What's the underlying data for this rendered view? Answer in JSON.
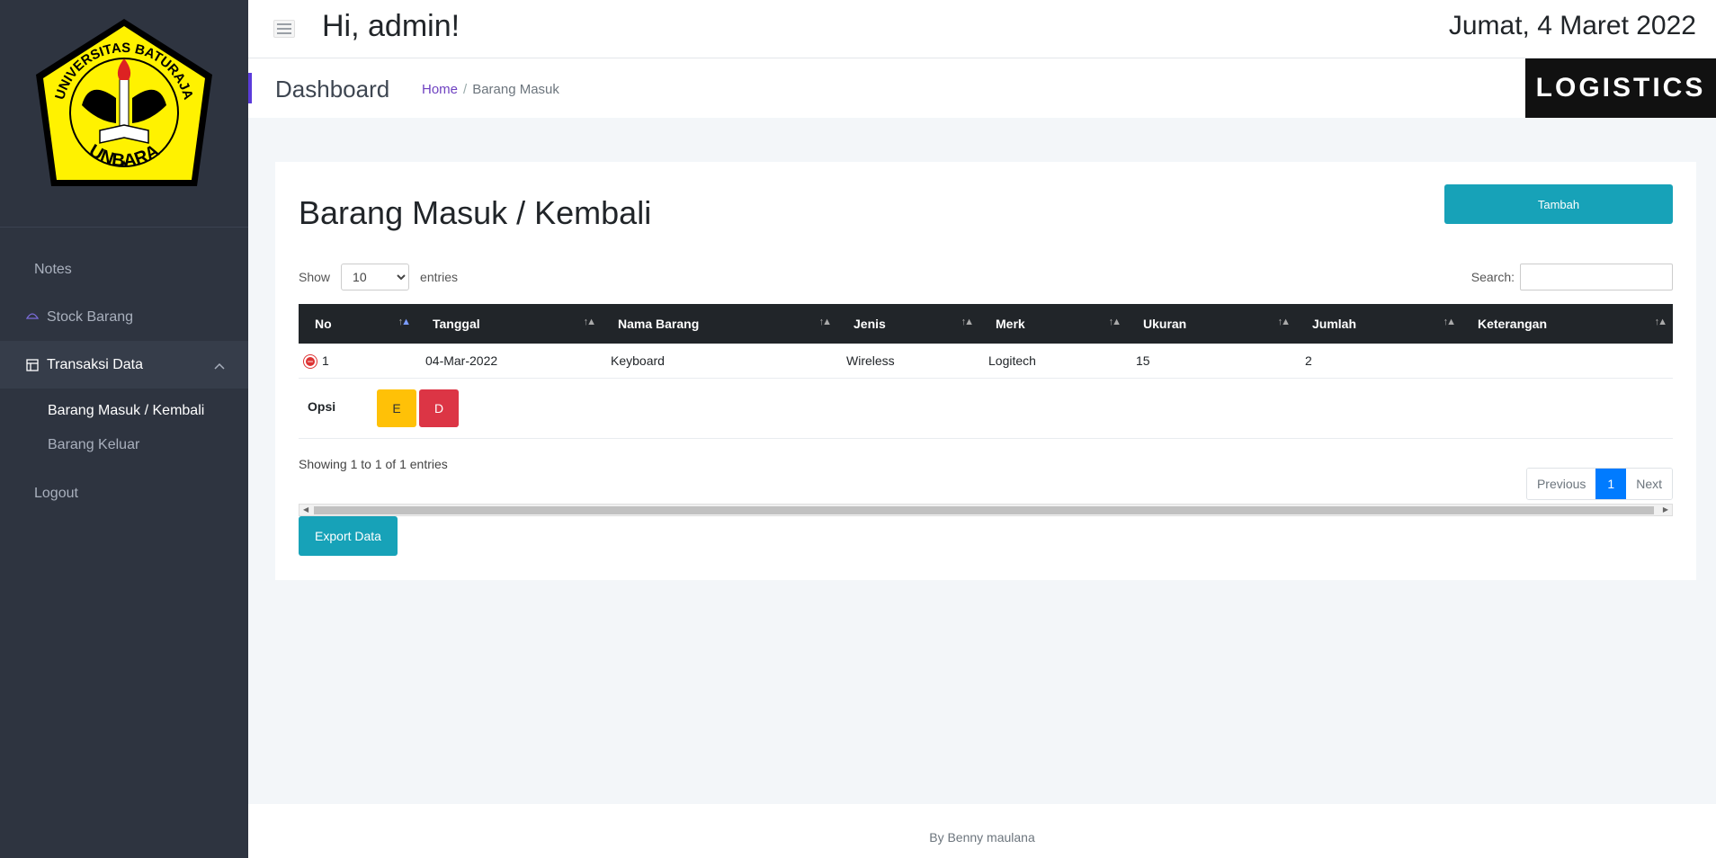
{
  "header": {
    "greeting": "Hi, admin!",
    "date": "Jumat, 4 Maret 2022"
  },
  "subheader": {
    "title": "Dashboard",
    "breadcrumb_home": "Home",
    "breadcrumb_sep": "/",
    "breadcrumb_current": "Barang Masuk",
    "brand": "LOGISTICS"
  },
  "logo": {
    "top_text": "UNIVERSITAS BATURAJA",
    "bottom_text": "UNBARA"
  },
  "sidebar": {
    "items": [
      {
        "label": "Notes"
      },
      {
        "label": "Stock Barang",
        "icon": "umbrella-icon"
      },
      {
        "label": "Transaksi Data",
        "icon": "layout-icon"
      },
      {
        "label": "Logout"
      }
    ],
    "sub_items": [
      {
        "label": "Barang Masuk / Kembali"
      },
      {
        "label": "Barang Keluar"
      }
    ]
  },
  "card": {
    "title": "Barang Masuk / Kembali",
    "add_button": "Tambah",
    "show_label": "Show",
    "entries_label": "entries",
    "page_size": "10",
    "search_label": "Search:",
    "search_value": "",
    "columns": [
      "No",
      "Tanggal",
      "Nama Barang",
      "Jenis",
      "Merk",
      "Ukuran",
      "Jumlah",
      "Keterangan"
    ],
    "rows": [
      {
        "no": "1",
        "tanggal": "04-Mar-2022",
        "nama": "Keyboard",
        "jenis": "Wireless",
        "merk": "Logitech",
        "ukuran": "15",
        "jumlah": "2",
        "keterangan": ""
      }
    ],
    "child": {
      "label": "Opsi",
      "edit": "E",
      "delete": "D"
    },
    "info": "Showing 1 to 1 of 1 entries",
    "pager": {
      "prev": "Previous",
      "current": "1",
      "next": "Next"
    },
    "export_button": "Export Data"
  },
  "footer": {
    "text": "By Benny maulana"
  },
  "colors": {
    "sidebar": "#2e3440",
    "accent": "#17a2b8",
    "header_table": "#212529",
    "brand_bg": "#111111",
    "primary": "#007bff"
  }
}
